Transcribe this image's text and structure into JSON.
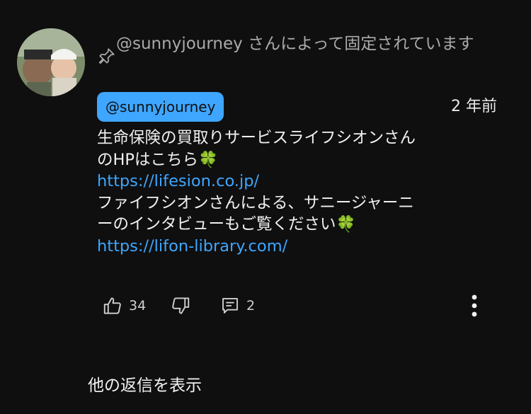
{
  "pinned": {
    "text": "@sunnyjourney さんによって固定されています"
  },
  "comment": {
    "author": "@sunnyjourney",
    "time": "2 年前",
    "lines": [
      "生命保険の買取りサービスライフシオンさん",
      "のHPはこちら🍀"
    ],
    "link1": "https://lifesion.co.jp/",
    "lines2": [
      "ファイフシオンさんによる、サニージャーニ",
      "ーのインタビューもご覧ください🍀"
    ],
    "link2": "https://lifon-library.com/"
  },
  "actions": {
    "like_count": "34",
    "reply_count": "2"
  },
  "view_replies_label": "他の返信を表示",
  "colors": {
    "background": "#0f0f0f",
    "link": "#3ea6ff",
    "chip_bg": "#3ea6ff"
  }
}
